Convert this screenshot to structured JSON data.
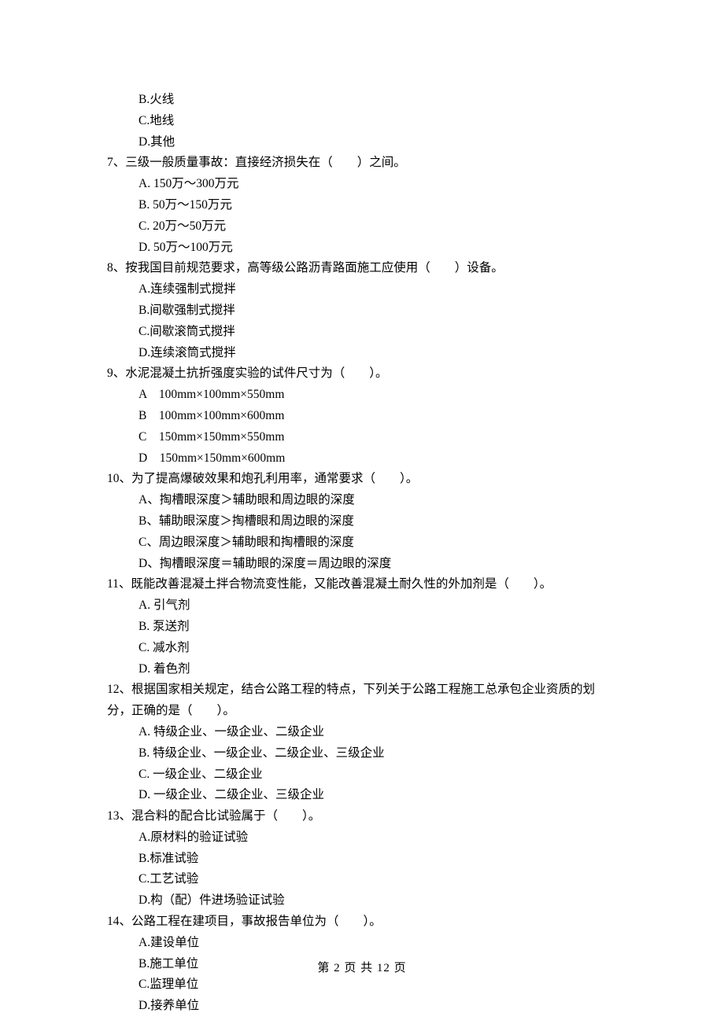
{
  "q6": {
    "options": {
      "B": "B.火线",
      "C": "C.地线",
      "D": "D.其他"
    }
  },
  "q7": {
    "stem": "7、三级一般质量事故：直接经济损失在（　　）之间。",
    "options": {
      "A": "A. 150万～300万元",
      "B": "B. 50万～150万元",
      "C": "C. 20万～50万元",
      "D": "D. 50万～100万元"
    }
  },
  "q8": {
    "stem": "8、按我国目前规范要求，高等级公路沥青路面施工应使用（　　）设备。",
    "options": {
      "A": "A.连续强制式搅拌",
      "B": "B.间歇强制式搅拌",
      "C": "C.间歇滚筒式搅拌",
      "D": "D.连续滚筒式搅拌"
    }
  },
  "q9": {
    "stem": "9、水泥混凝土抗折强度实验的试件尺寸为（　　）。",
    "options": {
      "A": "A　100mm×100mm×550mm",
      "B": "B　100mm×100mm×600mm",
      "C": "C　150mm×150mm×550mm",
      "D": "D　150mm×150mm×600mm"
    }
  },
  "q10": {
    "stem": "10、为了提高爆破效果和炮孔利用率，通常要求（　　）。",
    "options": {
      "A": "A、掏槽眼深度＞辅助眼和周边眼的深度",
      "B": "B、辅助眼深度＞掏槽眼和周边眼的深度",
      "C": "C、周边眼深度＞辅助眼和掏槽眼的深度",
      "D": "D、掏槽眼深度＝辅助眼的深度＝周边眼的深度"
    }
  },
  "q11": {
    "stem": "11、既能改善混凝土拌合物流变性能，又能改善混凝土耐久性的外加剂是（　　）。",
    "options": {
      "A": "A. 引气剂",
      "B": "B. 泵送剂",
      "C": "C. 减水剂",
      "D": "D. 着色剂"
    }
  },
  "q12": {
    "stem_line1": "12、根据国家相关规定，结合公路工程的特点，下列关于公路工程施工总承包企业资质的划",
    "stem_line2": "分，正确的是（　　）。",
    "options": {
      "A": "A. 特级企业、一级企业、二级企业",
      "B": "B. 特级企业、一级企业、二级企业、三级企业",
      "C": "C. 一级企业、二级企业",
      "D": "D. 一级企业、二级企业、三级企业"
    }
  },
  "q13": {
    "stem": "13、混合料的配合比试验属于（　　）。",
    "options": {
      "A": "A.原材料的验证试验",
      "B": "B.标准试验",
      "C": "C.工艺试验",
      "D": "D.构（配）件进场验证试验"
    }
  },
  "q14": {
    "stem": "14、公路工程在建项目，事故报告单位为（　　）。",
    "options": {
      "A": "A.建设单位",
      "B": "B.施工单位",
      "C": "C.监理单位",
      "D": "D.接养单位"
    }
  },
  "footer": "第 2 页 共 12 页"
}
